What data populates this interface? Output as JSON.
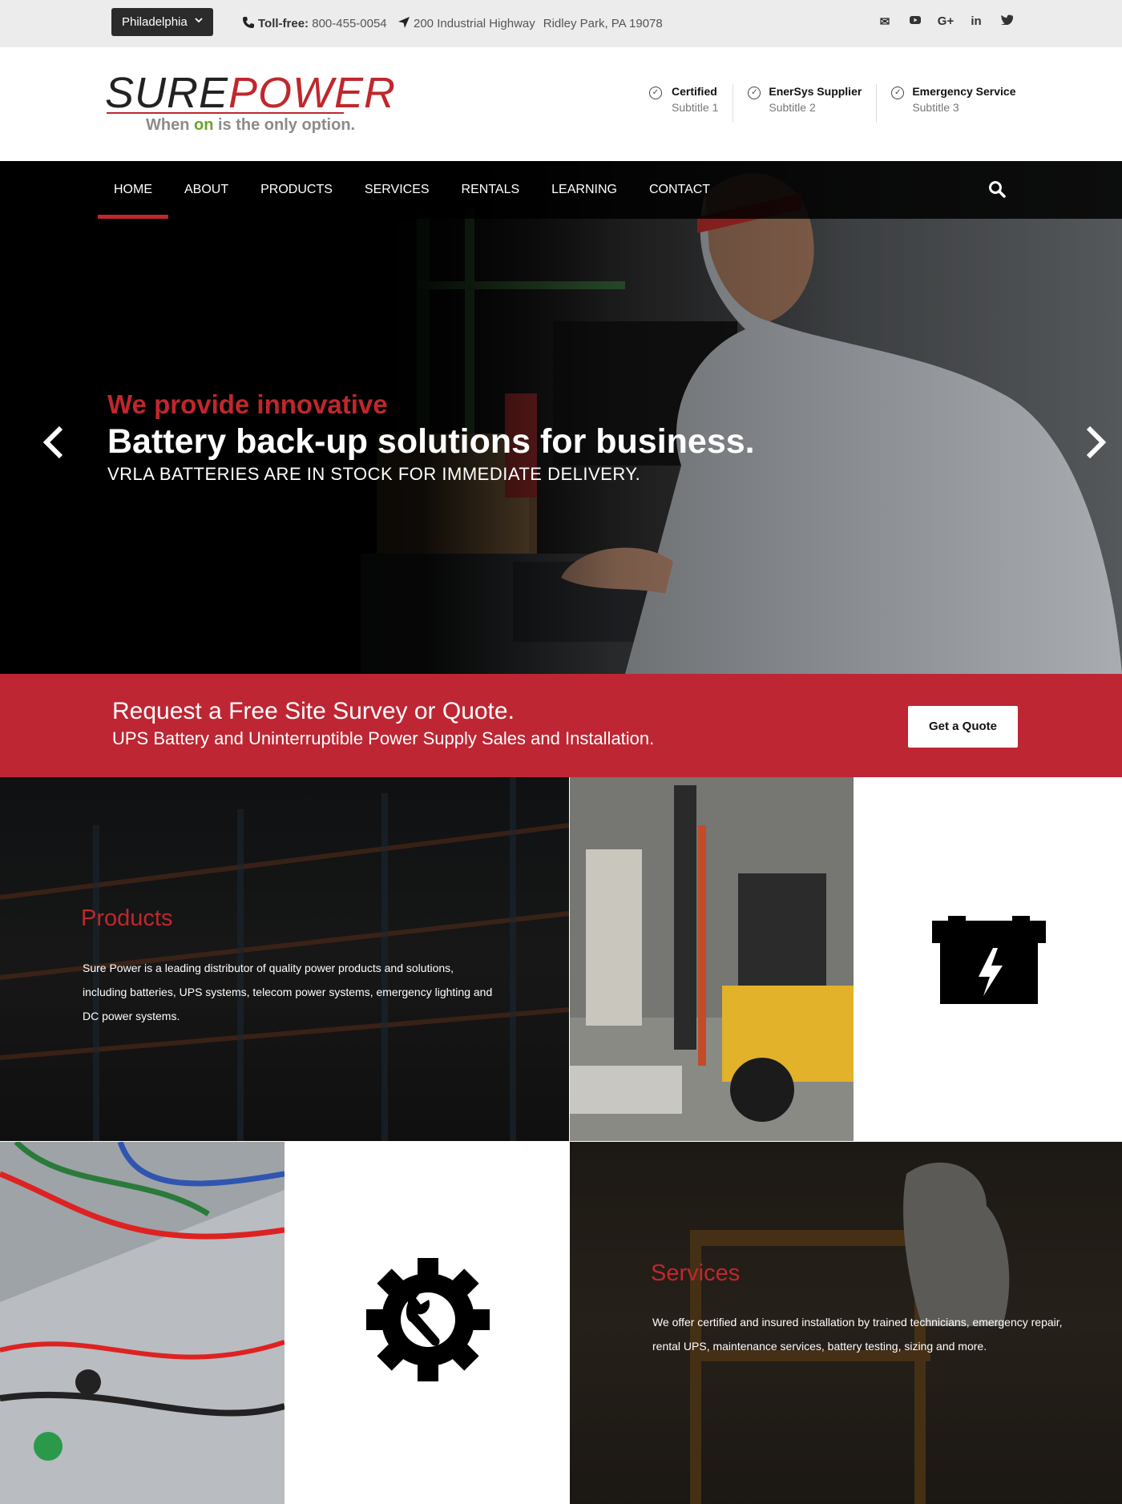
{
  "topbar": {
    "location": "Philadelphia",
    "phone_label": "Toll-free:",
    "phone_number": "800-455-0054",
    "address_line1": "200 Industrial Highway",
    "address_line2": "Ridley Park, PA 19078",
    "social_icons": [
      "envelope-icon",
      "youtube-icon",
      "google-plus-icon",
      "linkedin-icon",
      "twitter-icon"
    ],
    "social_glyphs": [
      "✉",
      "▶",
      "G+",
      "in",
      "🐦"
    ]
  },
  "header": {
    "logo": {
      "brand_1": "SURE",
      "brand_2": "POWER",
      "tagline_1": "When",
      "tagline_on": "on",
      "tagline_2": "is the only option."
    },
    "badges": [
      {
        "title": "Certified",
        "subtitle": "Subtitle 1"
      },
      {
        "title": "EnerSys Supplier",
        "subtitle": "Subtitle 2"
      },
      {
        "title": "Emergency Service",
        "subtitle": "Subtitle 3"
      }
    ]
  },
  "nav": {
    "items": [
      "HOME",
      "ABOUT",
      "PRODUCTS",
      "SERVICES",
      "RENTALS",
      "LEARNING",
      "CONTACT"
    ],
    "active": "HOME"
  },
  "hero": {
    "line1": "We provide innovative",
    "line2": "Battery back-up solutions for business.",
    "line3": "VRLA BATTERIES ARE IN STOCK FOR IMMEDIATE DELIVERY.",
    "prev": "‹",
    "next": "›"
  },
  "cta": {
    "heading": "Request a Free Site Survey or Quote.",
    "subheading": "UPS Battery and Uninterruptible Power Supply Sales and Installation.",
    "button": "Get a Quote"
  },
  "tiles": {
    "products": {
      "title": "Products",
      "text": "Sure Power is a leading distributor of quality power products and solutions, including batteries, UPS systems, telecom power systems, emergency lighting and DC power systems."
    },
    "services": {
      "title": "Services",
      "text": "We offer certified and insured installation by trained technicians, emergency repair, rental UPS, maintenance services, battery testing, sizing and more."
    }
  },
  "colors": {
    "brand_red": "#be2633",
    "nav_bg": "#000000",
    "topbar_bg": "#ececec",
    "tagline_green": "#6aa32a"
  }
}
